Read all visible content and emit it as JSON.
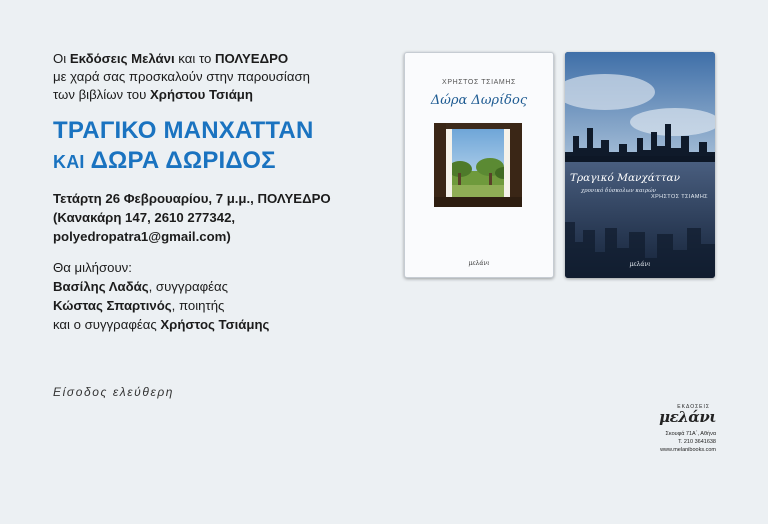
{
  "intro": {
    "line1_pre": "Οι ",
    "publisher": "Εκδόσεις Μελάνι",
    "line1_mid": " και το ",
    "venue": "ΠΟΛΥΕΔΡΟ",
    "line2": "με χαρά σας προσκαλούν στην παρουσίαση",
    "line3_pre": "των βιβλίων του ",
    "author": "Χρήστου Τσιάμη"
  },
  "event_title": {
    "line1": "ΤΡΑΓΙΚΟ ΜΑΝΧΑΤΤΑΝ",
    "kai": "ΚΑΙ",
    "line2": "ΔΩΡΑ ΔΩΡΙΔΟΣ"
  },
  "event_details": {
    "line1": "Τετάρτη 26 Φεβρουαρίου, 7 μ.μ., ΠΟΛΥΕΔΡΟ",
    "line2": "(Κανακάρη 147, 2610 277342,",
    "line3": "polyedropatra1@gmail.com)"
  },
  "speakers": {
    "heading": "Θα μιλήσουν:",
    "s1_name": "Βασίλης Λαδάς",
    "s1_role": ", συγγραφέας",
    "s2_name": "Κώστας Σπαρτινός",
    "s2_role": ", ποιητής",
    "s3_pre": "και ο συγγραφέας ",
    "s3_name": "Χρήστος Τσιάμης"
  },
  "entry": "Είσοδος ελεύθερη",
  "book1": {
    "author": "ΧΡΗΣΤΟΣ ΤΣΙΑΜΗΣ",
    "title": "Δώρα Δωρίδος",
    "publisher_mark": "μελάνι"
  },
  "book2": {
    "title": "Τραγικό Μανχάτταν",
    "subtitle": "χρονικό δύσκολων καιρών",
    "author": "ΧΡΗΣΤΟΣ ΤΣΙΑΜΗΣ",
    "publisher_mark": "μελάνι"
  },
  "imprint": {
    "label": "ΕΚΔΟΣΕΙΣ",
    "logo": "μελάνι",
    "address": "Σκουφά 71Α΄, Αθήνα",
    "phone": "Τ. 210 3641638",
    "website": "www.melanibooks.com"
  },
  "colors": {
    "accent_blue": "#1a73c0",
    "background": "#ecf0f3"
  }
}
